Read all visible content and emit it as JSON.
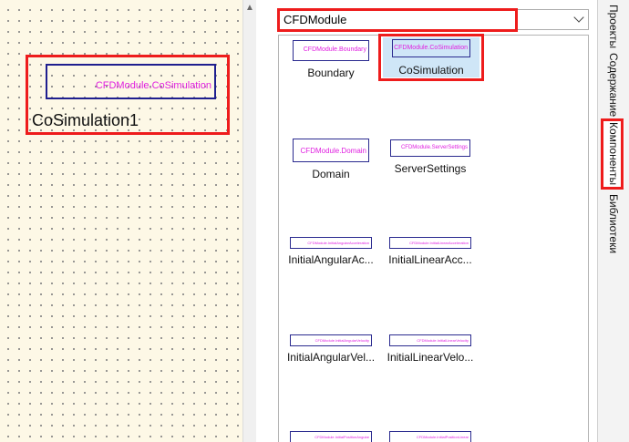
{
  "canvas": {
    "placed_component": {
      "box_text": "CFDModule.CoSimulation",
      "name": "CoSimulation1"
    }
  },
  "library": {
    "selected": "CFDModule",
    "components": [
      {
        "id": "boundary",
        "label": "Boundary",
        "icon_text": "CFDModule.Boundary"
      },
      {
        "id": "cosimulation",
        "label": "CoSimulation",
        "icon_text": "CFDModule.CoSimulation"
      },
      {
        "id": "domain",
        "label": "Domain",
        "icon_text": "CFDModule.Domain"
      },
      {
        "id": "server-settings",
        "label": "ServerSettings",
        "icon_text": "CFDModule.ServerSettings"
      },
      {
        "id": "initial-angular-acc",
        "label": "InitialAngularAc...",
        "icon_text": "CFDModule.InitialAngularAcceleration"
      },
      {
        "id": "initial-linear-acc",
        "label": "InitialLinearAcc...",
        "icon_text": "CFDModule.InitialLinearAcceleration"
      },
      {
        "id": "initial-angular-vel",
        "label": "InitialAngularVel...",
        "icon_text": "CFDModule.InitialAngularVelocity"
      },
      {
        "id": "initial-linear-velo",
        "label": "InitialLinearVelo...",
        "icon_text": "CFDModule.InitialLinearVelocity"
      },
      {
        "id": "initial-position-angular",
        "label": "",
        "icon_text": "CFDModule.InitialPositionAngular"
      },
      {
        "id": "initial-position-linear",
        "label": "",
        "icon_text": "CFDModule.InitialPositionLinear"
      }
    ]
  },
  "tabs": [
    {
      "label": "Проекты"
    },
    {
      "label": "Содержание"
    },
    {
      "label": "Компоненты"
    },
    {
      "label": "Библиотеки"
    }
  ],
  "colors": {
    "canvas_bg": "#fdf8e6",
    "highlight_red": "#ee1c1c",
    "icon_border": "#1f1f8f",
    "icon_text": "#e020e0",
    "selection_bg": "#cfe6f7"
  }
}
